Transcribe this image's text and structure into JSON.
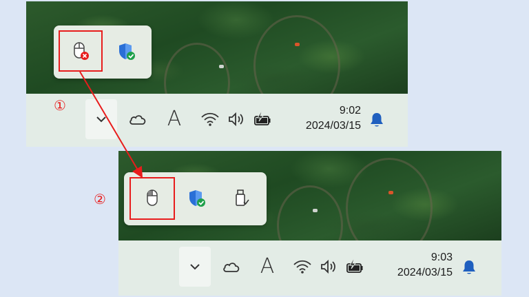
{
  "steps": {
    "first": "①",
    "second": "②"
  },
  "before": {
    "clock": {
      "time": "9:02",
      "date": "2024/03/15"
    },
    "flyout_icons": [
      "mouse-error-icon",
      "windows-security-icon"
    ]
  },
  "after": {
    "clock": {
      "time": "9:03",
      "date": "2024/03/15"
    },
    "flyout_icons": [
      "mouse-icon",
      "windows-security-icon",
      "usb-eject-icon"
    ]
  },
  "tray_icons": [
    "chevron-up-icon",
    "onedrive-cloud-icon",
    "ime-icon",
    "wifi-icon",
    "volume-icon",
    "battery-charging-icon",
    "notification-bell-icon"
  ],
  "ime_glyph": "A",
  "colors": {
    "highlight": "#e81c1c",
    "taskbar": "#e3ece6",
    "bell": "#1f5fbf",
    "shield": "#2a6fd6",
    "check": "#1ea04a",
    "background": "#dce6f5"
  }
}
